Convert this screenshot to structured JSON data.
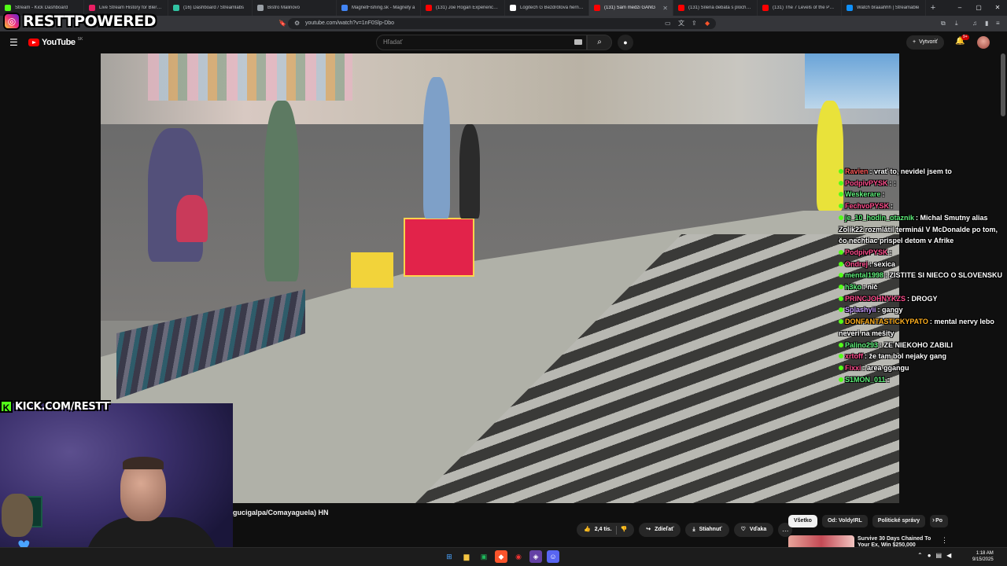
{
  "browser": {
    "tabs": [
      {
        "label": "Stream - Kick Dashboard",
        "color": "#53fc18"
      },
      {
        "label": "Live Stream History for Blerp S",
        "color": "#e91e63"
      },
      {
        "label": "(16) Dashboard / Streamlabs",
        "color": "#31c3a2"
      },
      {
        "label": "Bistro Malinovo",
        "color": "#9aa0a6"
      },
      {
        "label": "MagnetFishing.sk - Magnety a",
        "color": "#4285f4"
      },
      {
        "label": "(131) Joe Rogan Experience #2",
        "color": "#ff0000"
      },
      {
        "label": "Logitech G Bezdrôtová herná m",
        "color": "#ffffff"
      },
      {
        "label": "(131) Sám medzi GANG",
        "color": "#ff0000",
        "active": true
      },
      {
        "label": "(131) Šílená debata s plochoze",
        "color": "#ff0000"
      },
      {
        "label": "(131) The 7 Levels of the Psych",
        "color": "#ff0000"
      },
      {
        "label": "Watch braaahhh | Streamable",
        "color": "#0f90fa"
      }
    ],
    "new_tab": "+",
    "url": "youtube.com/watch?v=1nF0Slp-Dbo"
  },
  "overlay": {
    "instagram_handle": "RESTTPOWERED",
    "kick_handle": "KICK.COM/RESTT"
  },
  "youtube": {
    "logo_text": "YouTube",
    "country_code": "SK",
    "search_placeholder": "Hľadať",
    "create_label": "Vytvoriť",
    "notification_count": "9+",
    "video_title": "gucigalpa/Comayaguela) HN",
    "actions": {
      "likes": "2,4 tis.",
      "share": "Zdieľať",
      "download": "Stiahnuť",
      "thanks": "Vďaka",
      "more": "…"
    },
    "chips": [
      {
        "label": "Všetko",
        "active": true
      },
      {
        "label": "Od: VoldyIRL"
      },
      {
        "label": "Politické správy"
      },
      {
        "label": "Po"
      }
    ],
    "recommendation": {
      "title": "Survive 30 Days Chained To Your Ex, Win $250,000"
    }
  },
  "chat": [
    {
      "user": "Ravien",
      "user_color": "#ff5a5a",
      "text": "vrať to, nevidel jsem to"
    },
    {
      "user": "PodpivPYSK",
      "user_color": "#ff4d8d",
      "text": ":"
    },
    {
      "user": "Weskerare",
      "user_color": "#5ef07a",
      "text": ""
    },
    {
      "user": "FechvoPYSK",
      "user_color": "#ff4d8d",
      "text": ""
    },
    {
      "user": "je_10_hodin_otaznik",
      "user_color": "#5ef07a",
      "text": "Michal Smutny alias Zolik22 rozmlátil terminál V McDonalde po tom, čo nechtiac prispel detom v Afrike"
    },
    {
      "user": "PodpivPYSK",
      "user_color": "#ff4d8d",
      "text": ""
    },
    {
      "user": "Ondrej",
      "user_color": "#ff4d8d",
      "text": "sexica"
    },
    {
      "user": "mental1998",
      "user_color": "#5ef07a",
      "text": "ZISTITE SI NIECO O SLOVENSKU"
    },
    {
      "user": "h3ko",
      "user_color": "#5ef07a",
      "text": "nič"
    },
    {
      "user": "PRINCJOHNYKZS",
      "user_color": "#ff4d8d",
      "text": "DROGY"
    },
    {
      "user": "Splashyii",
      "user_color": "#c79bff",
      "text": "gangy"
    },
    {
      "user": "DONFANTASTICKYPATO",
      "user_color": "#ffb020",
      "text": "mental nervy lebo neveri na mešity"
    },
    {
      "user": "Palino293",
      "user_color": "#5ef07a",
      "text": "ZE  NIEKOHO ZABILI"
    },
    {
      "user": "xrtoff",
      "user_color": "#ff4d8d",
      "text": "že tam bol nejaky gang"
    },
    {
      "user": "Fixxi",
      "user_color": "#ff4d8d",
      "text": "area ggangu"
    },
    {
      "user": "S1MON_011",
      "user_color": "#5ef07a",
      "text": ""
    }
  ],
  "taskbar": {
    "time": "1:18 AM",
    "date": "9/15/2025"
  },
  "icons": {
    "hamburger": "☰",
    "search": "⌕",
    "mic": "🎤",
    "plus": "+",
    "bell": "🔔",
    "like": "👍",
    "dislike": "👎",
    "share": "↪",
    "download": "⤓",
    "thanks": "♡",
    "chevron_right": "›",
    "more_vert": "⋮",
    "windows": "⊞"
  },
  "colors": {
    "yt_red": "#ff0000",
    "kick_green": "#53fc18",
    "bg": "#0f0f0f"
  }
}
